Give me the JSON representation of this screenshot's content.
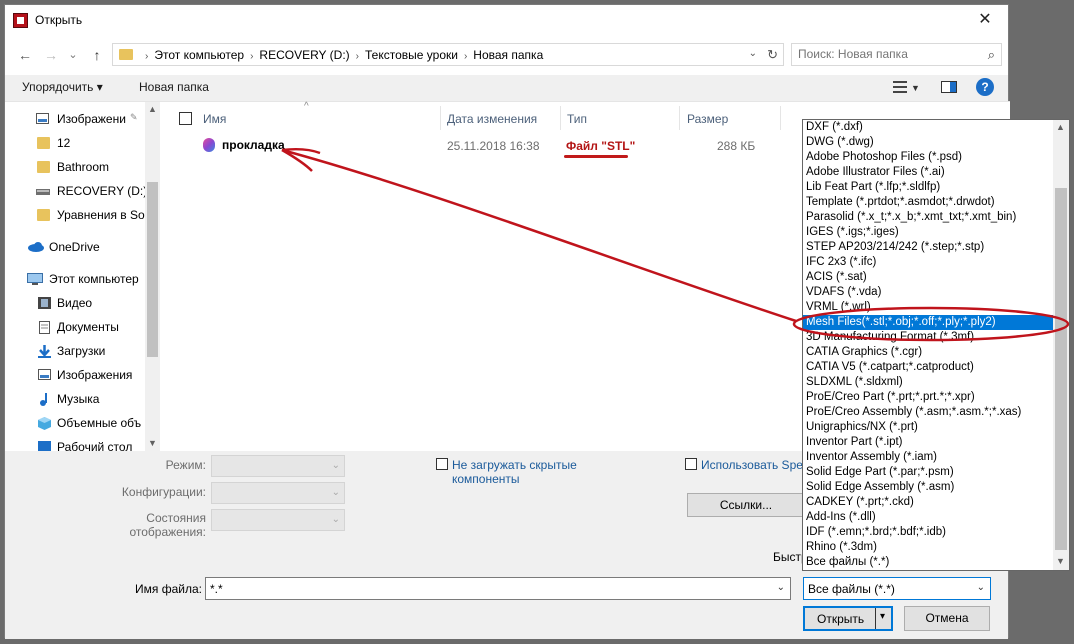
{
  "window": {
    "title": "Открыть",
    "close_glyph": "✕"
  },
  "nav": {
    "back": "←",
    "forward": "→",
    "dropdown": "⌄",
    "up": "↑",
    "breadcrumb": [
      "Этот компьютер",
      "RECOVERY (D:)",
      "Текстовые уроки",
      "Новая папка"
    ],
    "breadcrumb_sep": "›",
    "refresh": "↻",
    "search_placeholder": "Поиск: Новая папка",
    "search_glyph": "⌕"
  },
  "toolbar": {
    "organize": "Упорядочить ▾",
    "new_folder": "Новая папка",
    "help": "?"
  },
  "sidebar": {
    "items": [
      {
        "label": "Изображени",
        "icon": "pictures-icon",
        "pinned": true
      },
      {
        "label": "12",
        "icon": "folder-icon"
      },
      {
        "label": "Bathroom",
        "icon": "folder-icon"
      },
      {
        "label": "RECOVERY (D:)",
        "icon": "drive-icon"
      },
      {
        "label": "Уравнения в Sol",
        "icon": "folder-icon"
      },
      {
        "label": "OneDrive",
        "icon": "cloud-icon"
      },
      {
        "label": "Этот компьютер",
        "icon": "computer-icon"
      },
      {
        "label": "Видео",
        "icon": "video-icon"
      },
      {
        "label": "Документы",
        "icon": "documents-icon"
      },
      {
        "label": "Загрузки",
        "icon": "downloads-icon"
      },
      {
        "label": "Изображения",
        "icon": "pictures-icon"
      },
      {
        "label": "Музыка",
        "icon": "music-icon"
      },
      {
        "label": "Объемные объ",
        "icon": "3d-objects-icon"
      },
      {
        "label": "Рабочий стол",
        "icon": "desktop-icon"
      }
    ],
    "pin_glyph": "📌",
    "scroll_up": "▲",
    "scroll_down": "▼"
  },
  "columns": {
    "name": "Имя",
    "date": "Дата изменения",
    "type": "Тип",
    "size": "Размер",
    "sort_glyph": "^"
  },
  "files": [
    {
      "name": "прокладка",
      "date": "25.11.2018 16:38",
      "type": "Файл \"STL\"",
      "size": "288 КБ"
    }
  ],
  "options": {
    "mode_label": "Режим:",
    "config_label": "Конфигурации:",
    "states_label": "Состояния отображения:",
    "no_hidden_label": "Не загружать скрытые компоненты",
    "use_spec_label": "Использовать Spec",
    "links_button": "Ссылки...",
    "fast_label": "Быстр",
    "combo_arrow": "⌄"
  },
  "filename": {
    "label": "Имя файла:",
    "value": "*.*",
    "arrow": "⌄"
  },
  "filetype": {
    "value": "Все файлы (*.*)",
    "arrow": "⌄",
    "options": [
      "DXF (*.dxf)",
      "DWG (*.dwg)",
      "Adobe Photoshop Files (*.psd)",
      "Adobe Illustrator Files (*.ai)",
      "Lib Feat Part (*.lfp;*.sldlfp)",
      "Template (*.prtdot;*.asmdot;*.drwdot)",
      "Parasolid (*.x_t;*.x_b;*.xmt_txt;*.xmt_bin)",
      "IGES (*.igs;*.iges)",
      "STEP AP203/214/242 (*.step;*.stp)",
      "IFC 2x3 (*.ifc)",
      "ACIS (*.sat)",
      "VDAFS (*.vda)",
      "VRML (*.wrl)",
      "Mesh Files(*.stl;*.obj;*.off;*.ply;*.ply2)",
      "3D Manufacturing Format (*.3mf)",
      "CATIA Graphics (*.cgr)",
      "CATIA V5 (*.catpart;*.catproduct)",
      "SLDXML (*.sldxml)",
      "ProE/Creo Part (*.prt;*.prt.*;*.xpr)",
      "ProE/Creo Assembly (*.asm;*.asm.*;*.xas)",
      "Unigraphics/NX (*.prt)",
      "Inventor Part (*.ipt)",
      "Inventor Assembly (*.iam)",
      "Solid Edge Part (*.par;*.psm)",
      "Solid Edge Assembly (*.asm)",
      "CADKEY (*.prt;*.ckd)",
      "Add-Ins (*.dll)",
      "IDF (*.emn;*.brd;*.bdf;*.idb)",
      "Rhino (*.3dm)",
      "Все файлы (*.*)"
    ],
    "selected_index": 13,
    "scroll_up": "▲",
    "scroll_down": "▼"
  },
  "buttons": {
    "open": "Открыть",
    "open_dd": "▾",
    "cancel": "Отмена"
  },
  "colors": {
    "annotation": "#c0141c",
    "selection": "#0078d7"
  }
}
